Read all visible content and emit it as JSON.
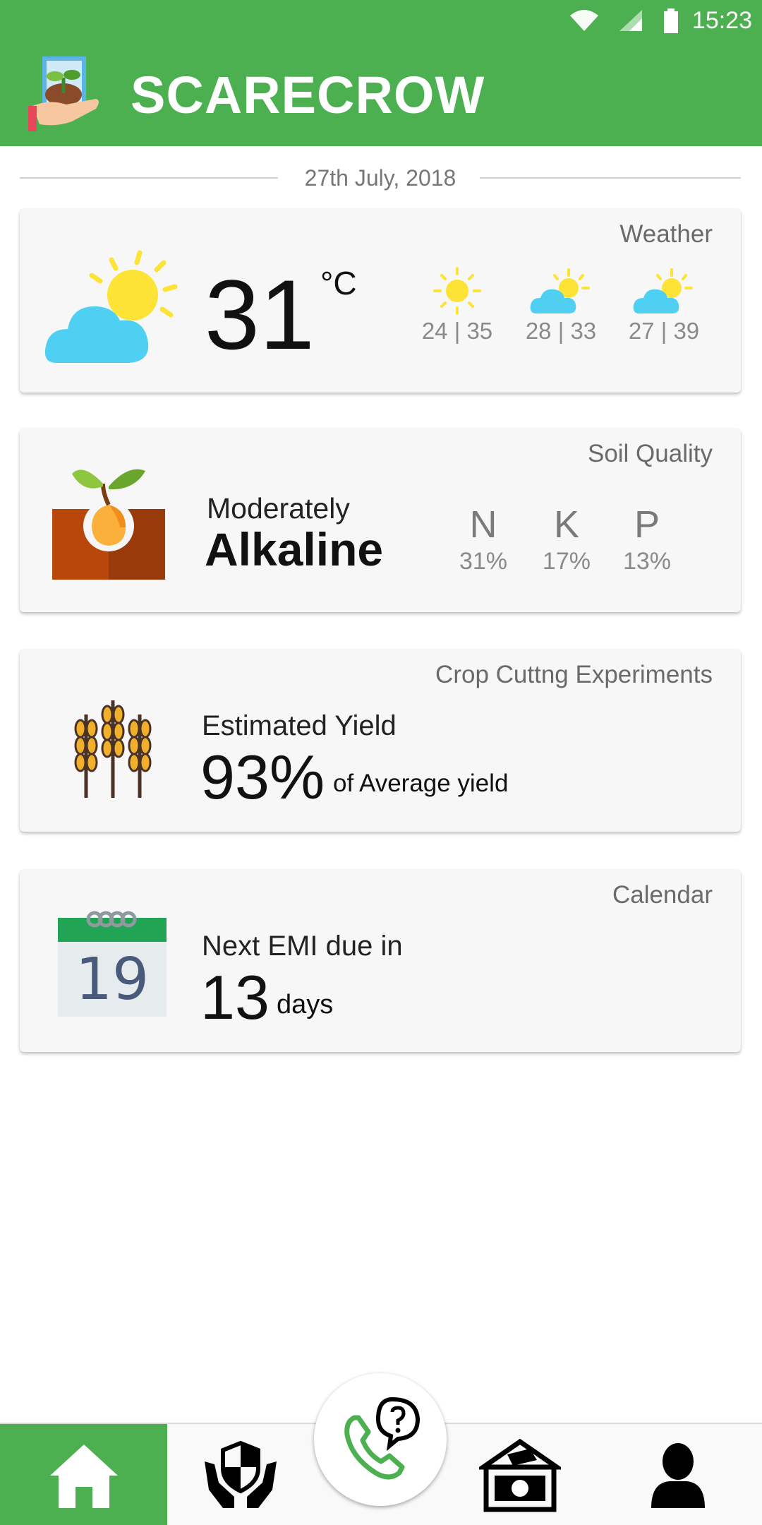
{
  "status_bar": {
    "time": "15:23"
  },
  "app": {
    "title": "SCARECROW",
    "brand_color": "#4caf50"
  },
  "date": "27th July, 2018",
  "weather": {
    "title": "Weather",
    "temperature": "31",
    "unit": "°C",
    "forecast": [
      {
        "icon": "sun-icon",
        "range": "24 | 35"
      },
      {
        "icon": "partly-cloudy-icon",
        "range": "28 | 33"
      },
      {
        "icon": "partly-cloudy-icon",
        "range": "27 | 39"
      }
    ]
  },
  "soil": {
    "title": "Soil Quality",
    "level": "Moderately",
    "type": "Alkaline",
    "nutrients": [
      {
        "letter": "N",
        "value": "31%"
      },
      {
        "letter": "K",
        "value": "17%"
      },
      {
        "letter": "P",
        "value": "13%"
      }
    ]
  },
  "crop": {
    "title": "Crop Cuttng Experiments",
    "label": "Estimated Yield",
    "value": "93%",
    "suffix": "of Average yield"
  },
  "calendar": {
    "title": "Calendar",
    "icon_day": "19",
    "label": "Next EMI due in",
    "value": "13",
    "suffix": "days"
  },
  "nav": {
    "items": [
      "home-icon",
      "insurance-icon",
      "help-call-icon",
      "money-icon",
      "profile-icon"
    ],
    "active": "home-icon"
  }
}
